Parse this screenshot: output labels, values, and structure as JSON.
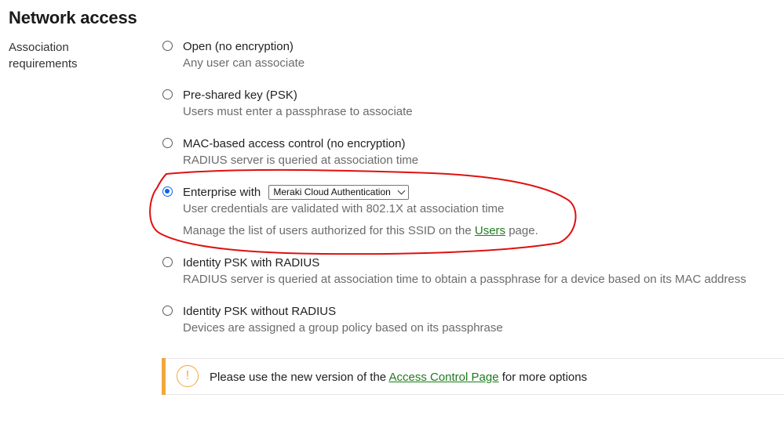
{
  "page": {
    "title": "Network access"
  },
  "section": {
    "label": "Association requirements"
  },
  "options": [
    {
      "title": "Open (no encryption)",
      "desc": "Any user can associate",
      "checked": false
    },
    {
      "title": "Pre-shared key (PSK)",
      "desc": "Users must enter a passphrase to associate",
      "checked": false
    },
    {
      "title": "MAC-based access control (no encryption)",
      "desc": "RADIUS server is queried at association time",
      "checked": false
    },
    {
      "title": "Enterprise with",
      "select_value": "Meraki Cloud Authentication",
      "desc": "User credentials are validated with 802.1X at association time",
      "note_prefix": "Manage the list of users authorized for this SSID on the",
      "note_link": "Users",
      "note_suffix": "page.",
      "checked": true
    },
    {
      "title": "Identity PSK with RADIUS",
      "desc": "RADIUS server is queried at association time to obtain a passphrase for a device based on its MAC address",
      "checked": false
    },
    {
      "title": "Identity PSK without RADIUS",
      "desc": "Devices are assigned a group policy based on its passphrase",
      "checked": false
    }
  ],
  "alert": {
    "icon": "exclamation",
    "prefix": "Please use the new version of the",
    "link": "Access Control Page",
    "suffix": "for more options"
  },
  "colors": {
    "accent_radio": "#0b64e4",
    "link": "#1f7a1f",
    "alert_bar": "#f0a83c",
    "annotation": "#e01010"
  }
}
